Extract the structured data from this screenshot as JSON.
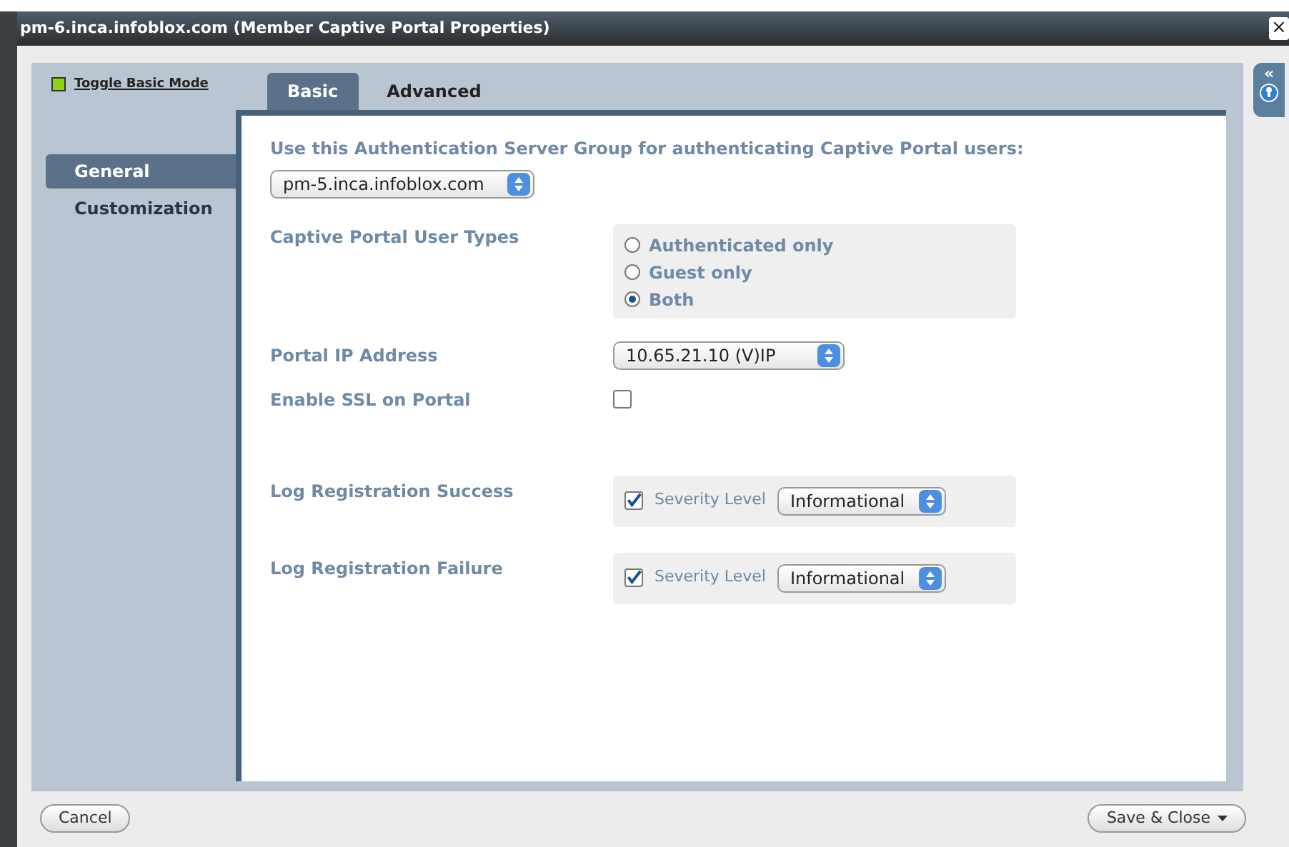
{
  "window": {
    "title": "pm-6.inca.infoblox.com (Member Captive Portal Properties)",
    "close": "×"
  },
  "mode_toggle": {
    "label": "Toggle Basic Mode",
    "on": true
  },
  "side_panel": {
    "collapse": "«"
  },
  "sidebar": {
    "items": [
      {
        "label": "General",
        "selected": true
      },
      {
        "label": "Customization",
        "selected": false
      }
    ]
  },
  "tabs": [
    {
      "label": "Basic",
      "selected": true
    },
    {
      "label": "Advanced",
      "selected": false
    }
  ],
  "auth_group": {
    "label": "Use this Authentication Server Group for authenticating Captive Portal users:",
    "value": "pm-5.inca.infoblox.com"
  },
  "user_types": {
    "label": "Captive Portal User Types",
    "options": [
      {
        "label": "Authenticated only",
        "selected": false
      },
      {
        "label": "Guest only",
        "selected": false
      },
      {
        "label": "Both",
        "selected": true
      }
    ]
  },
  "portal_ip": {
    "label": "Portal IP Address",
    "value": "10.65.21.10 (V)IP"
  },
  "enable_ssl": {
    "label": "Enable SSL on Portal",
    "checked": false
  },
  "log_rows": [
    {
      "label": "Log Registration Success",
      "checked": true,
      "severity_label": "Severity Level",
      "severity": "Informational"
    },
    {
      "label": "Log Registration Failure",
      "checked": true,
      "severity_label": "Severity Level",
      "severity": "Informational"
    }
  ],
  "footer": {
    "cancel": "Cancel",
    "save": "Save & Close"
  }
}
